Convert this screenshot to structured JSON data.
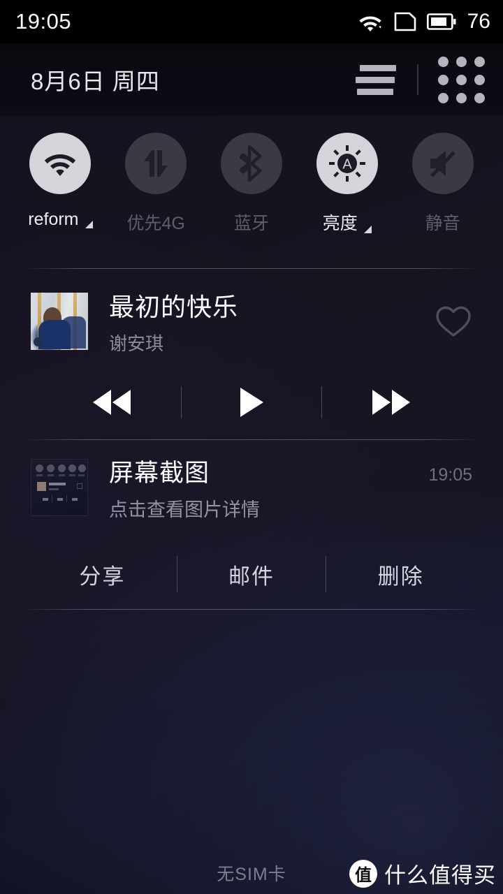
{
  "statusbar": {
    "time": "19:05",
    "battery_percent": "76",
    "icons": [
      "wifi-download-icon",
      "sim-card-icon",
      "battery-icon"
    ]
  },
  "header": {
    "date": "8月6日  周四",
    "list_icon": "list-lines-icon",
    "grid_icon": "app-grid-icon"
  },
  "toggles": [
    {
      "name": "wifi",
      "icon": "wifi-icon",
      "label": "reform",
      "active": true,
      "has_caret": true
    },
    {
      "name": "mobile-data",
      "icon": "data-arrows-icon",
      "label": "优先4G",
      "active": false,
      "has_caret": false
    },
    {
      "name": "bluetooth",
      "icon": "bluetooth-icon",
      "label": "蓝牙",
      "active": false,
      "has_caret": false
    },
    {
      "name": "brightness",
      "icon": "brightness-auto-icon",
      "label": "亮度",
      "active": true,
      "has_caret": true
    },
    {
      "name": "mute",
      "icon": "mute-speaker-icon",
      "label": "静音",
      "active": false,
      "has_caret": false
    }
  ],
  "music": {
    "title": "最初的快乐",
    "artist": "谢安琪",
    "album_art": "carousel-photo-album-art",
    "favorite_icon": "heart-outline-icon",
    "favorited": false,
    "controls": [
      {
        "name": "previous-button",
        "icon": "rewind-icon"
      },
      {
        "name": "play-button",
        "icon": "play-icon"
      },
      {
        "name": "next-button",
        "icon": "fast-forward-icon"
      }
    ]
  },
  "screenshot_notification": {
    "title": "屏幕截图",
    "subtitle": "点击查看图片详情",
    "time": "19:05",
    "thumbnail": "screenshot-thumbnail",
    "actions": [
      {
        "name": "share-action",
        "label": "分享"
      },
      {
        "name": "mail-action",
        "label": "邮件"
      },
      {
        "name": "delete-action",
        "label": "删除"
      }
    ]
  },
  "footer": {
    "sim_status": "无SIM卡",
    "watermark_badge": "值",
    "watermark_text": "什么值得买"
  },
  "colors": {
    "accent_on": "#d4d4da",
    "toggle_off": "#3a3a45",
    "text_primary": "#ffffff",
    "text_secondary": "#8b8b99",
    "background": "#15121f"
  }
}
